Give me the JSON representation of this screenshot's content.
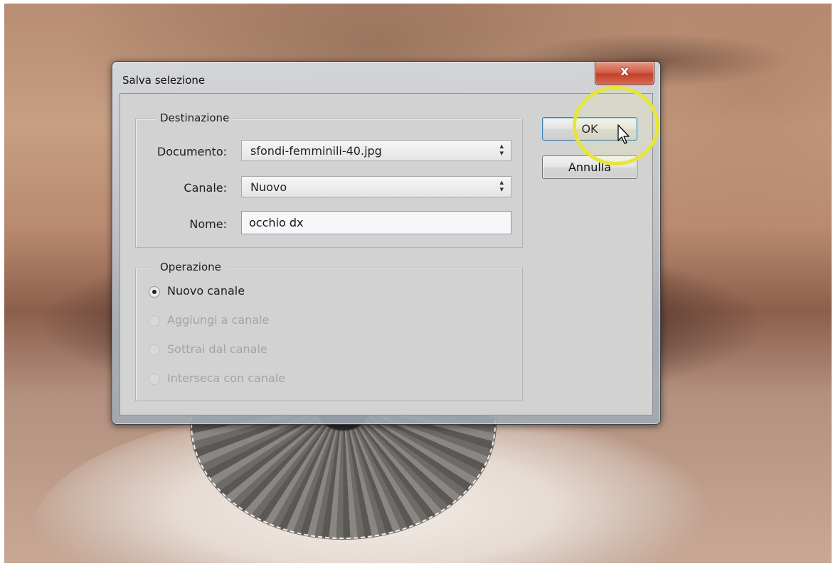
{
  "dialog": {
    "title": "Salva selezione",
    "close_glyph": "x",
    "destination": {
      "legend": "Destinazione",
      "document_label": "Documento:",
      "document_value": "sfondi-femminili-40.jpg",
      "channel_label": "Canale:",
      "channel_value": "Nuovo",
      "name_label": "Nome:",
      "name_value": "occhio dx"
    },
    "operation": {
      "legend": "Operazione",
      "options": [
        {
          "label": "Nuovo canale",
          "selected": true,
          "enabled": true
        },
        {
          "label": "Aggiungi a canale",
          "selected": false,
          "enabled": false
        },
        {
          "label": "Sottrai dal canale",
          "selected": false,
          "enabled": false
        },
        {
          "label": "Interseca con canale",
          "selected": false,
          "enabled": false
        }
      ]
    },
    "buttons": {
      "ok": "OK",
      "cancel": "Annulla"
    }
  },
  "icons": {
    "close": "close-icon",
    "select_arrows": "up-down-arrows-icon",
    "cursor": "mouse-pointer-icon"
  },
  "colors": {
    "highlight": "#e6e639",
    "close_button": "#c2412a",
    "dialog_bg": "#d2d2d2"
  }
}
